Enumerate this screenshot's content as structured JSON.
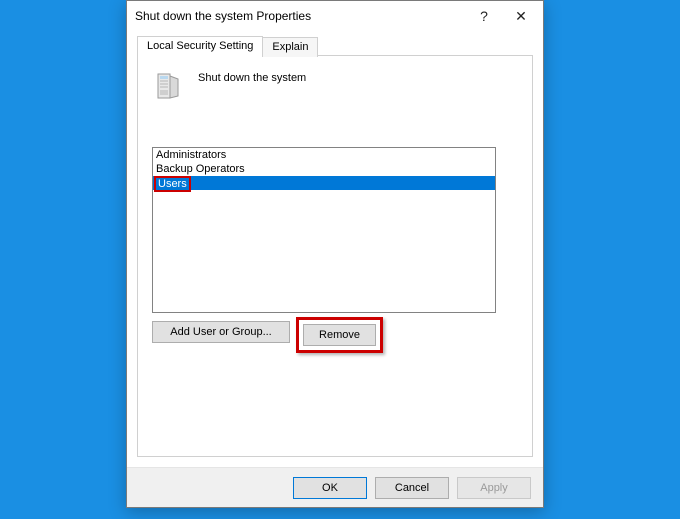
{
  "window": {
    "title": "Shut down the system Properties",
    "help_glyph": "?",
    "close_glyph": "✕"
  },
  "tabs": {
    "active": "Local Security Setting",
    "inactive": "Explain"
  },
  "policy": {
    "label": "Shut down the system"
  },
  "list": {
    "items": [
      "Administrators",
      "Backup Operators"
    ],
    "selected": "Users"
  },
  "buttons": {
    "add": "Add User or Group...",
    "remove": "Remove",
    "ok": "OK",
    "cancel": "Cancel",
    "apply": "Apply"
  }
}
